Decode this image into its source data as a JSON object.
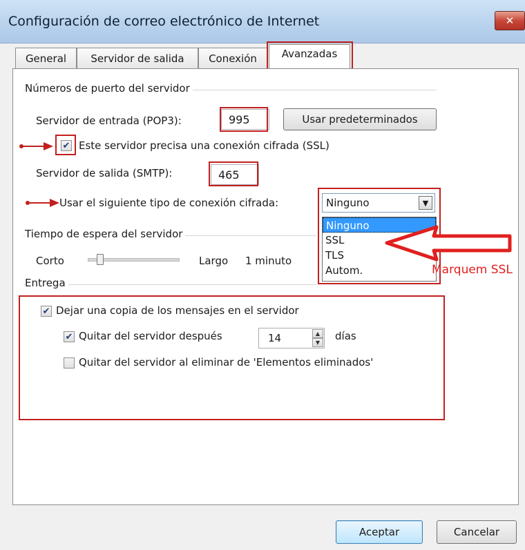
{
  "window": {
    "title": "Configuración de correo electrónico de Internet",
    "close_icon": "close-icon"
  },
  "tabs": [
    {
      "label": "General",
      "active": false
    },
    {
      "label": "Servidor de salida",
      "active": false
    },
    {
      "label": "Conexión",
      "active": false
    },
    {
      "label": "Avanzadas",
      "active": true
    }
  ],
  "ports": {
    "group_label": "Números de puerto del servidor",
    "incoming_label": "Servidor de entrada (POP3):",
    "incoming_value": "995",
    "defaults_button": "Usar predeterminados",
    "ssl_checkbox_label": "Este servidor precisa una conexión cifrada (SSL)",
    "ssl_checked": true,
    "outgoing_label": "Servidor de salida (SMTP):",
    "outgoing_value": "465",
    "encryption_label": "Usar el siguiente tipo de conexión cifrada:",
    "encryption_selected": "Ninguno",
    "encryption_options": [
      "Ninguno",
      "SSL",
      "TLS",
      "Autom."
    ]
  },
  "timeout": {
    "group_label": "Tiempo de espera del servidor",
    "short_label": "Corto",
    "long_label": "Largo",
    "value_label": "1 minuto"
  },
  "delivery": {
    "group_label": "Entrega",
    "leave_copy_label": "Dejar una copia de los mensajes en el servidor",
    "leave_copy_checked": true,
    "remove_after_label": "Quitar del servidor después",
    "remove_after_checked": true,
    "days_value": "14",
    "days_label": "días",
    "remove_deleted_label": "Quitar del servidor al eliminar de 'Elementos eliminados'",
    "remove_deleted_checked": false
  },
  "footer": {
    "ok_button": "Aceptar",
    "cancel_button": "Cancelar"
  },
  "annotation": {
    "text": "Marquem SSL",
    "color": "#e0201f"
  }
}
